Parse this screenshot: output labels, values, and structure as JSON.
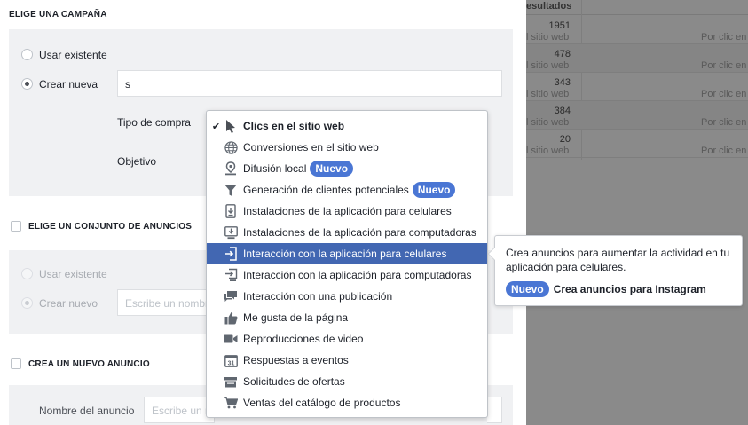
{
  "background_table": {
    "header": "esultados",
    "rows": [
      {
        "value": "1951",
        "sub": "l sitio web",
        "sub2": "Por clic en"
      },
      {
        "value": "478",
        "sub": "l sitio web",
        "sub2": "Por clic en"
      },
      {
        "value": "343",
        "sub": "l sitio web",
        "sub2": "Por clic en"
      },
      {
        "value": "384",
        "sub": "l sitio web",
        "sub2": "Por clic en"
      },
      {
        "value": "20",
        "sub": "l sitio web",
        "sub2": "Por clic en"
      }
    ]
  },
  "campaign": {
    "title": "ELIGE UNA CAMPAÑA",
    "use_existing": "Usar existente",
    "create_new": "Crear nueva",
    "name_value": "s",
    "purchase_type_label": "Tipo de compra",
    "objective_label": "Objetivo"
  },
  "adset": {
    "title": "ELIGE UN CONJUNTO DE ANUNCIOS",
    "use_existing": "Usar existente",
    "create_new": "Crear nuevo",
    "name_placeholder": "Escribe un nombre"
  },
  "ad": {
    "title": "CREA UN NUEVO ANUNCIO",
    "name_label": "Nombre del anuncio",
    "name_placeholder": "Escribe un nombre"
  },
  "dropdown": {
    "items": [
      {
        "label": "Clics en el sitio web",
        "icon": "cursor-icon",
        "checked": true,
        "badge": ""
      },
      {
        "label": "Conversiones en el sitio web",
        "icon": "globe-icon",
        "checked": false,
        "badge": ""
      },
      {
        "label": "Difusión local",
        "icon": "map-pin-icon",
        "checked": false,
        "badge": "Nuevo"
      },
      {
        "label": "Generación de clientes potenciales",
        "icon": "funnel-icon",
        "checked": false,
        "badge": "Nuevo"
      },
      {
        "label": "Instalaciones de la aplicación para celulares",
        "icon": "phone-download-icon",
        "checked": false,
        "badge": ""
      },
      {
        "label": "Instalaciones de la aplicación para computadoras",
        "icon": "desktop-download-icon",
        "checked": false,
        "badge": ""
      },
      {
        "label": "Interacción con la aplicación para celulares",
        "icon": "phone-enter-icon",
        "checked": false,
        "badge": "",
        "selected": true
      },
      {
        "label": "Interacción con la aplicación para computadoras",
        "icon": "desktop-enter-icon",
        "checked": false,
        "badge": ""
      },
      {
        "label": "Interacción con una publicación",
        "icon": "speech-bubbles-icon",
        "checked": false,
        "badge": ""
      },
      {
        "label": "Me gusta de la página",
        "icon": "thumbs-up-icon",
        "checked": false,
        "badge": ""
      },
      {
        "label": "Reproducciones de video",
        "icon": "video-camera-icon",
        "checked": false,
        "badge": ""
      },
      {
        "label": "Respuestas a eventos",
        "icon": "calendar-icon",
        "checked": false,
        "badge": ""
      },
      {
        "label": "Solicitudes de ofertas",
        "icon": "offer-icon",
        "checked": false,
        "badge": ""
      },
      {
        "label": "Ventas del catálogo de productos",
        "icon": "cart-icon",
        "checked": false,
        "badge": ""
      }
    ],
    "check_glyph": "✔"
  },
  "tooltip": {
    "text": "Crea anuncios para aumentar la actividad en tu aplicación para celulares.",
    "badge": "Nuevo",
    "promo": "Crea anuncios para Instagram"
  },
  "colors": {
    "accent": "#4267b2",
    "badge": "#4a76d4",
    "gray_section": "#f0f1f3"
  }
}
